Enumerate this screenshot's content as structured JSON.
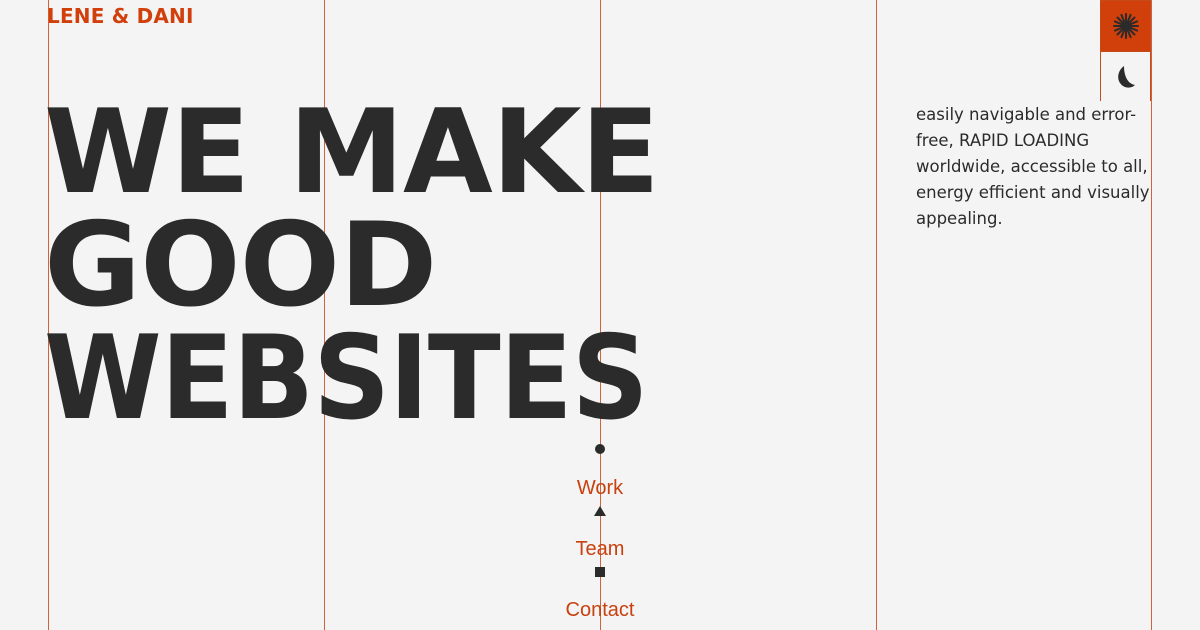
{
  "brand": {
    "name": "LENE & DANI"
  },
  "hero": {
    "headline_lines": [
      "WE MAKE",
      "GOOD",
      "WEBSITES"
    ]
  },
  "intro": {
    "text": "easily navigable and error-free, RAPID LOADING worldwide, accessible to all, energy efficient and visually appealing."
  },
  "theme_toggle": {
    "light_icon": "sun-icon",
    "dark_icon": "moon-icon",
    "active": "light"
  },
  "nav": {
    "items": [
      {
        "label": "Work",
        "marker": "circle"
      },
      {
        "label": "Team",
        "marker": "triangle"
      },
      {
        "label": "Contact",
        "marker": "square"
      }
    ]
  },
  "colors": {
    "accent": "#d13f0b",
    "grid_line": "#c54a1c",
    "text": "#2b2b2b",
    "background": "#f4f4f4"
  }
}
